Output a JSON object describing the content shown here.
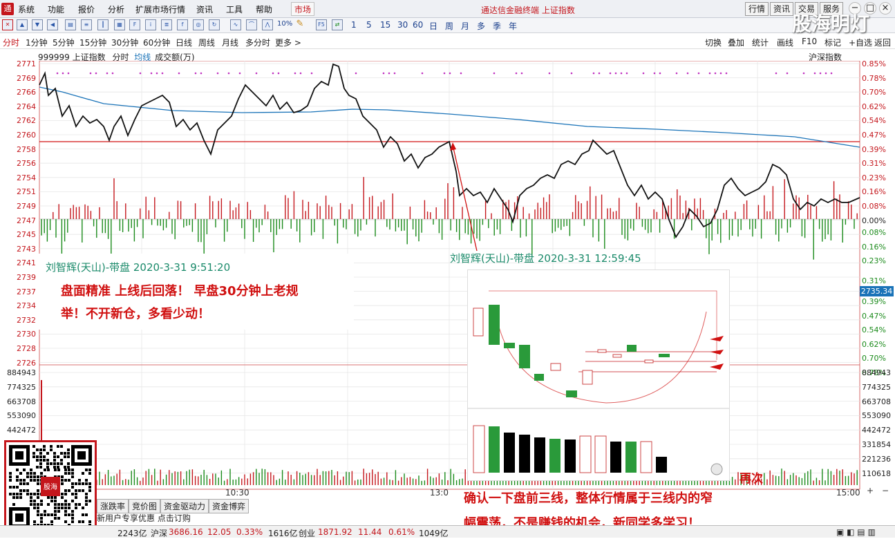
{
  "menubar": {
    "logo": "通",
    "items": [
      "系统",
      "功能",
      "报价",
      "分析",
      "扩展市场行情",
      "资讯",
      "工具",
      "帮助"
    ],
    "market_tab": "市场",
    "app_title": "通达信金融终端 上证指数",
    "buttons": [
      "行情",
      "资讯",
      "交易",
      "服务"
    ]
  },
  "toolbar": {
    "icons": [
      "close-icon",
      "up-arrow-icon",
      "down-arrow-icon",
      "back-icon",
      "table-icon",
      "list-icon",
      "minute-chart-icon",
      "kline-icon",
      "f10-icon",
      "report-icon",
      "info-icon",
      "formula-icon",
      "search-icon",
      "refresh-icon",
      "indicator-icon",
      "chart-icon",
      "line-icon",
      "percent-icon",
      "pencil-icon",
      "f5-icon",
      "sync-icon"
    ],
    "percent_label": "10%",
    "f5": "F5",
    "periods": [
      "1",
      "5",
      "15",
      "30",
      "60",
      "日",
      "周",
      "月",
      "多",
      "季",
      "年"
    ]
  },
  "period_bar": {
    "items": [
      "分时",
      "1分钟",
      "5分钟",
      "15分钟",
      "30分钟",
      "60分钟",
      "日线",
      "周线",
      "月线",
      "多分时",
      "更多 >"
    ],
    "active": "分时",
    "right": [
      "切换",
      "叠加",
      "统计",
      "画线",
      "F10",
      "标记",
      "+自选",
      "返回"
    ]
  },
  "legend": {
    "code": "999999 上证指数",
    "mode": "分时",
    "avg": "均线",
    "vol": "成交额(万)"
  },
  "market_label": "沪深指数",
  "axis": {
    "left_price": [
      "2771",
      "2769",
      "2766",
      "2764",
      "2762",
      "2760",
      "2758",
      "2756",
      "2754",
      "2751",
      "2749",
      "2747",
      "2745",
      "2743",
      "2741",
      "2739",
      "2737",
      "2734",
      "2732",
      "2730",
      "2728",
      "2726"
    ],
    "left_vol": [
      "884943",
      "774325",
      "663708",
      "553090",
      "442472"
    ],
    "right_pct_up": [
      "0.85%",
      "0.78%",
      "0.70%",
      "0.62%",
      "0.54%",
      "0.47%",
      "0.39%",
      "0.31%",
      "0.23%",
      "0.16%",
      "0.08%",
      "0.00%"
    ],
    "right_pct_down": [
      "0.08%",
      "0.16%",
      "0.23%",
      "0.31%",
      "0.39%",
      "0.47%",
      "0.54%",
      "0.62%",
      "0.70%",
      "0.78%"
    ],
    "right_vol": [
      "884943",
      "774325",
      "663708",
      "553090",
      "442472",
      "331854",
      "221236",
      "110618"
    ],
    "price_badge": "2735.34"
  },
  "time_labels": [
    "10:30",
    "13:0",
    "15:00"
  ],
  "notes": {
    "first": {
      "header": "刘智辉(天山)-带盘 2020-3-31 9:51:20",
      "line1": "盘面精准 上线后回落！ 早盘30分钟上老规",
      "line2": "举！不开新仓，多看少动！"
    },
    "second": {
      "header": "刘智辉(天山)-带盘 2020-3-31 12:59:45",
      "more": "再次",
      "line1": "确认一下盘前三线，整体行情属于三线内的窄",
      "line2": "幅震荡，不是赚钱的机会，新同学多学习！"
    }
  },
  "bottom_tabs": [
    "涨跌率",
    "竞价图",
    "资金驱动力",
    "资金博弈"
  ],
  "promo": "新用户专享优惠 点击订购",
  "statusbar": {
    "sh_amount": "2243亿",
    "sz_label": "沪深",
    "sz_index": "3686.16",
    "sz_change": "12.05",
    "sz_pct": "0.33%",
    "sz_amount": "1616亿",
    "cy_label": "创业",
    "cy_index": "1871.92",
    "cy_change": "11.44",
    "cy_pct": "0.61%",
    "cy_amount": "1049亿"
  },
  "watermark": "股海明灯",
  "colors": {
    "red": "#c4161c",
    "green": "#1a8a1a",
    "blue": "#1a73b8"
  }
}
